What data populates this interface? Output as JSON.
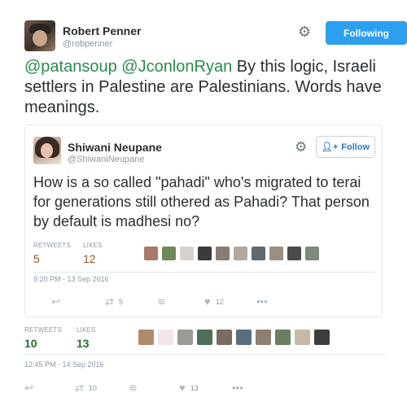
{
  "tweet": {
    "author_name": "Robert Penner",
    "author_handle": "@robpenner",
    "follow_label": "Following",
    "mentions": [
      "@patansoup",
      "@JconlonRyan"
    ],
    "text": " By this logic, Israeli settlers in Palestine are Palestinians. Words have meanings.",
    "retweets_label": "RETWEETS",
    "retweets": "10",
    "likes_label": "LIKES",
    "likes": "13",
    "timestamp": "12:45 PM - 14 Sep 2016",
    "actions": {
      "retweet_count": "10",
      "like_count": "13"
    }
  },
  "quoted": {
    "author_name": "Shiwani Neupane",
    "author_handle": "@ShiwaniNeupane",
    "follow_label": "Follow",
    "text": "How is a so called \"pahadi\" who's migrated to terai for generations still othered as Pahadi? That person by default is madhesi no?",
    "retweets_label": "RETWEETS",
    "retweets": "5",
    "likes_label": "LIKES",
    "likes": "12",
    "timestamp": "9:20 PM - 13 Sep 2016",
    "actions": {
      "retweet_count": "5",
      "like_count": "12"
    }
  },
  "icons": {
    "gear": "gear-icon",
    "reply": "reply-icon",
    "retweet": "retweet-icon",
    "buffer": "buffer-icon",
    "like": "heart-icon",
    "more": "more-icon",
    "add_user": "add-user-icon"
  },
  "colors": {
    "follow_button": "#2b9ff0",
    "mention": "#2a8a4a",
    "muted": "#8899a6",
    "border": "#e1e8ed"
  }
}
